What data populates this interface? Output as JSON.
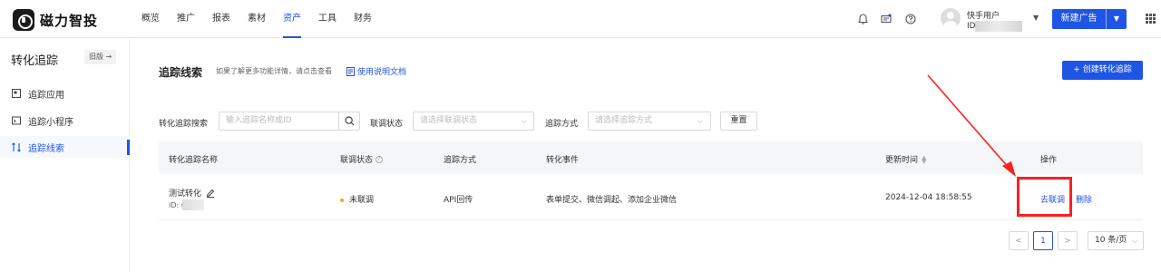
{
  "brand": {
    "name": "磁力智投"
  },
  "nav": {
    "items": [
      "概览",
      "推广",
      "报表",
      "素材",
      "资产",
      "工具",
      "财务"
    ],
    "active": "资产"
  },
  "header": {
    "user_name": "快手用户",
    "user_id_prefix": "ID:",
    "new_ad_label": "新建广告"
  },
  "icons": {
    "bell": "bell-icon",
    "message": "message-icon",
    "help": "help-icon",
    "apps": "apps-grid-icon"
  },
  "sidebar": {
    "title": "转化追踪",
    "old_version_label": "旧版 →",
    "items": [
      {
        "label": "追踪应用",
        "icon": "app-icon",
        "active": false
      },
      {
        "label": "追踪小程序",
        "icon": "mini-program-icon",
        "active": false
      },
      {
        "label": "追踪线索",
        "icon": "leads-icon",
        "active": true
      }
    ]
  },
  "main": {
    "title": "追踪线索",
    "hint": "如果了解更多功能详情，请点击查看",
    "doc_link": "使用说明文档",
    "create_button": "+ 创建转化追踪"
  },
  "filters": {
    "search_label": "转化追踪搜索",
    "search_placeholder": "输入追踪名称或ID",
    "status_label": "联调状态",
    "status_placeholder": "请选择联调状态",
    "method_label": "追踪方式",
    "method_placeholder": "请选择追踪方式",
    "reset_label": "重置"
  },
  "table": {
    "columns": [
      "转化追踪名称",
      "联调状态",
      "追踪方式",
      "转化事件",
      "更新时间",
      "操作"
    ],
    "rows": [
      {
        "name": "测试转化",
        "id_prefix": "ID: 6",
        "status": "未联调",
        "method": "API回传",
        "events": "表单提交、微信调起、添加企业微信",
        "updated": "2024-12-04 18:58:55",
        "action_debug": "去联调",
        "action_delete": "删除"
      }
    ]
  },
  "pagination": {
    "prev": "<",
    "current_page": "1",
    "next": ">",
    "page_size": "10 条/页"
  },
  "colors": {
    "accent": "#1f55e5",
    "status_pending": "#f5a623",
    "annotation": "#ff1f1f"
  }
}
